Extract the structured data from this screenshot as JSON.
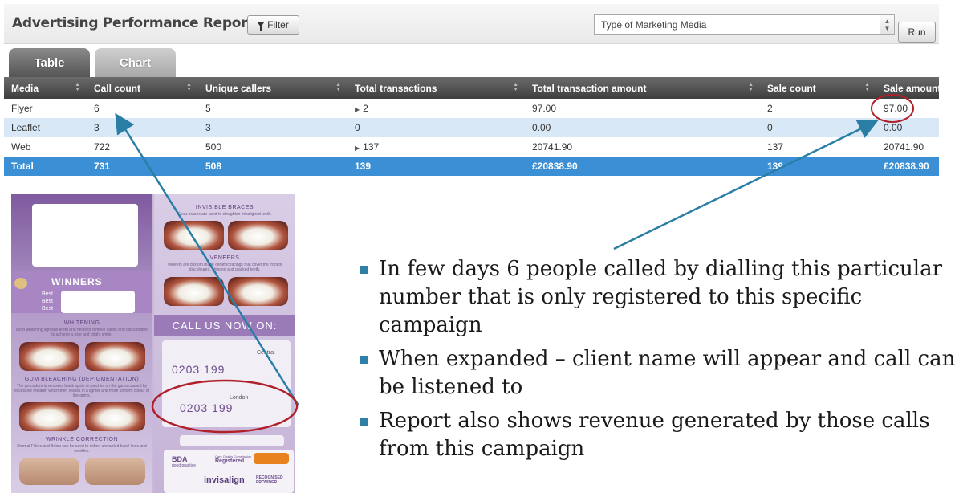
{
  "report": {
    "title": "Advertising Performance Report",
    "filter_label": "Filter",
    "media_select_value": "Type of Marketing Media",
    "run_label": "Run",
    "tabs": [
      {
        "label": "Table",
        "active": true
      },
      {
        "label": "Chart",
        "active": false
      }
    ]
  },
  "table": {
    "columns": [
      "Media",
      "Call count",
      "Unique callers",
      "Total transactions",
      "Total transaction amount",
      "Sale count",
      "Sale amount"
    ],
    "rows": [
      {
        "media": "Flyer",
        "call_count": "6",
        "unique_callers": "5",
        "total_transactions": "2",
        "total_transaction_amount": "97.00",
        "sale_count": "2",
        "sale_amount": "97.00"
      },
      {
        "media": "Leaflet",
        "call_count": "3",
        "unique_callers": "3",
        "total_transactions": "0",
        "total_transaction_amount": "0.00",
        "sale_count": "0",
        "sale_amount": "0.00"
      },
      {
        "media": "Web",
        "call_count": "722",
        "unique_callers": "500",
        "total_transactions": "137",
        "total_transaction_amount": "20741.90",
        "sale_count": "137",
        "sale_amount": "20741.90"
      }
    ],
    "total": {
      "media": "Total",
      "call_count": "731",
      "unique_callers": "508",
      "total_transactions": "139",
      "total_transaction_amount": "£20838.90",
      "sale_count": "139",
      "sale_amount": "£20838.90"
    }
  },
  "flyer": {
    "winners": "WINNERS",
    "winners_sub": [
      "Best",
      "Best",
      "Best"
    ],
    "whitening": "WHITENING",
    "whitening_text": "Tooth whitening lightens teeth and helps to remove stains and discoloration to achieve a nice and bright smile.",
    "gum_bleaching": "GUM BLEACHING (DEPIGMENTATION)",
    "gum_text": "The procedure is removes black spots or patches on the gums caused by excessive Melanin which then results in a lighter and more uniform colour of the gums.",
    "wrinkle": "WRINKLE CORRECTION",
    "wrinkle_text": "Dermal Fillers and Botox can be used to soften unwanted facial lines and wrinkles.",
    "invisible_braces": "INVISIBLE BRACES",
    "braces_text": "Clear braces are used to straighten misaligned teeth.",
    "veneers": "VENEERS",
    "veneers_text": "Veneers are custom made ceramic facings that cover the front of discoloured, chipped and cracked teeth.",
    "call_us": "CALL US NOW ON:",
    "central": "Central",
    "london": "London",
    "phone_1": "0203 199",
    "phone_2": "0203 199",
    "bda": "BDA",
    "bda_sub": "good practice",
    "cqc": "Care Quality Commission",
    "cqc_sub": "Registered",
    "invisalign": "invisalign",
    "recognised": "RECOGNISED",
    "provider": "PROVIDER"
  },
  "bullets": [
    "In few days 6 people called by dialling this particular number that is only registered to this specific campaign",
    "When expanded – client name will appear and call can be listened to",
    "Report also shows revenue generated by those calls from this campaign"
  ],
  "colors": {
    "header_dark": "#4a4a4a",
    "row_alt": "#d8e8f6",
    "total_row": "#3b8fd5",
    "arrow": "#2a7ea6",
    "circle": "#b0202a",
    "bullet": "#2f7fa6"
  }
}
